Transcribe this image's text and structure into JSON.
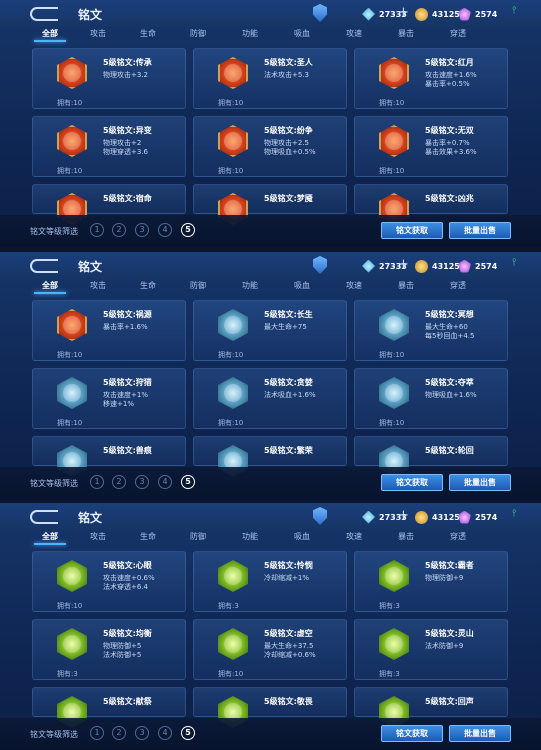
{
  "header": {
    "title": "铭文",
    "currency_1": "27333",
    "currency_2": "43125",
    "currency_3": "2574",
    "plus": "+"
  },
  "tabs": [
    "全部",
    "攻击",
    "生命",
    "防御",
    "功能",
    "吸血",
    "攻速",
    "暴击",
    "穿透"
  ],
  "footer": {
    "filter_label": "铭文等级筛选",
    "levels": [
      "1",
      "2",
      "3",
      "4",
      "5"
    ],
    "active_level": "5",
    "get_button": "铭文获取",
    "sell_button": "批量出售"
  },
  "icons": {
    "back": "back-arrow-icon",
    "shield": "shield-icon",
    "crystal": "crystal-icon",
    "coin": "gold-coin-icon",
    "gem": "diamond-icon",
    "signal": "signal-icon"
  },
  "colors": {
    "red_tier": "#d6411b",
    "blue_tier": "#5aa0c4",
    "green_tier": "#7fbc25",
    "accent": "#4fb4ff"
  },
  "panels": [
    {
      "cards": [
        {
          "name": "5级铭文:传承",
          "a1": "物理攻击+3.2",
          "a2": "",
          "owned": "拥有:10",
          "tier": "red"
        },
        {
          "name": "5级铭文:圣人",
          "a1": "法术攻击+5.3",
          "a2": "",
          "owned": "拥有:10",
          "tier": "red"
        },
        {
          "name": "5级铭文:红月",
          "a1": "攻击速度+1.6%",
          "a2": "暴击率+0.5%",
          "owned": "拥有:10",
          "tier": "red"
        },
        {
          "name": "5级铭文:异变",
          "a1": "物理攻击+2",
          "a2": "物理穿透+3.6",
          "owned": "拥有:10",
          "tier": "red"
        },
        {
          "name": "5级铭文:纷争",
          "a1": "物理攻击+2.5",
          "a2": "物理吸血+0.5%",
          "owned": "拥有:10",
          "tier": "red"
        },
        {
          "name": "5级铭文:无双",
          "a1": "暴击率+0.7%",
          "a2": "暴击效果+3.6%",
          "owned": "拥有:10",
          "tier": "red"
        },
        {
          "name": "5级铭文:宿命",
          "a1": "",
          "a2": "",
          "owned": "",
          "tier": "red"
        },
        {
          "name": "5级铭文:梦魇",
          "a1": "",
          "a2": "",
          "owned": "",
          "tier": "red"
        },
        {
          "name": "5级铭文:凶兆",
          "a1": "",
          "a2": "",
          "owned": "",
          "tier": "red"
        }
      ]
    },
    {
      "cards": [
        {
          "name": "5级铭文:祸源",
          "a1": "暴击率+1.6%",
          "a2": "",
          "owned": "拥有:10",
          "tier": "red"
        },
        {
          "name": "5级铭文:长生",
          "a1": "最大生命+75",
          "a2": "",
          "owned": "拥有:10",
          "tier": "blue"
        },
        {
          "name": "5级铭文:冥想",
          "a1": "最大生命+60",
          "a2": "每5秒回血+4.5",
          "owned": "拥有:10",
          "tier": "blue"
        },
        {
          "name": "5级铭文:狩猎",
          "a1": "攻击速度+1%",
          "a2": "移速+1%",
          "owned": "拥有:10",
          "tier": "blue"
        },
        {
          "name": "5级铭文:贪婪",
          "a1": "法术吸血+1.6%",
          "a2": "",
          "owned": "拥有:10",
          "tier": "blue"
        },
        {
          "name": "5级铭文:夺萃",
          "a1": "物理吸血+1.6%",
          "a2": "",
          "owned": "拥有:10",
          "tier": "blue"
        },
        {
          "name": "5级铭文:兽痕",
          "a1": "",
          "a2": "",
          "owned": "",
          "tier": "blue"
        },
        {
          "name": "5级铭文:繁荣",
          "a1": "",
          "a2": "",
          "owned": "",
          "tier": "blue"
        },
        {
          "name": "5级铭文:轮回",
          "a1": "",
          "a2": "",
          "owned": "",
          "tier": "blue"
        }
      ]
    },
    {
      "cards": [
        {
          "name": "5级铭文:心眼",
          "a1": "攻击速度+0.6%",
          "a2": "法术穿透+6.4",
          "owned": "拥有:10",
          "tier": "green"
        },
        {
          "name": "5级铭文:怜悯",
          "a1": "冷却缩减+1%",
          "a2": "",
          "owned": "拥有:3",
          "tier": "green"
        },
        {
          "name": "5级铭文:霸者",
          "a1": "物理防御+9",
          "a2": "",
          "owned": "拥有:3",
          "tier": "green"
        },
        {
          "name": "5级铭文:均衡",
          "a1": "物理防御+5",
          "a2": "法术防御+5",
          "owned": "拥有:3",
          "tier": "green"
        },
        {
          "name": "5级铭文:虚空",
          "a1": "最大生命+37.5",
          "a2": "冷却缩减+0.6%",
          "owned": "拥有:10",
          "tier": "green"
        },
        {
          "name": "5级铭文:灵山",
          "a1": "法术防御+9",
          "a2": "",
          "owned": "拥有:3",
          "tier": "green"
        },
        {
          "name": "5级铭文:献祭",
          "a1": "",
          "a2": "",
          "owned": "",
          "tier": "green"
        },
        {
          "name": "5级铭文:敬畏",
          "a1": "",
          "a2": "",
          "owned": "",
          "tier": "green"
        },
        {
          "name": "5级铭文:回声",
          "a1": "",
          "a2": "",
          "owned": "",
          "tier": "green"
        }
      ]
    }
  ]
}
